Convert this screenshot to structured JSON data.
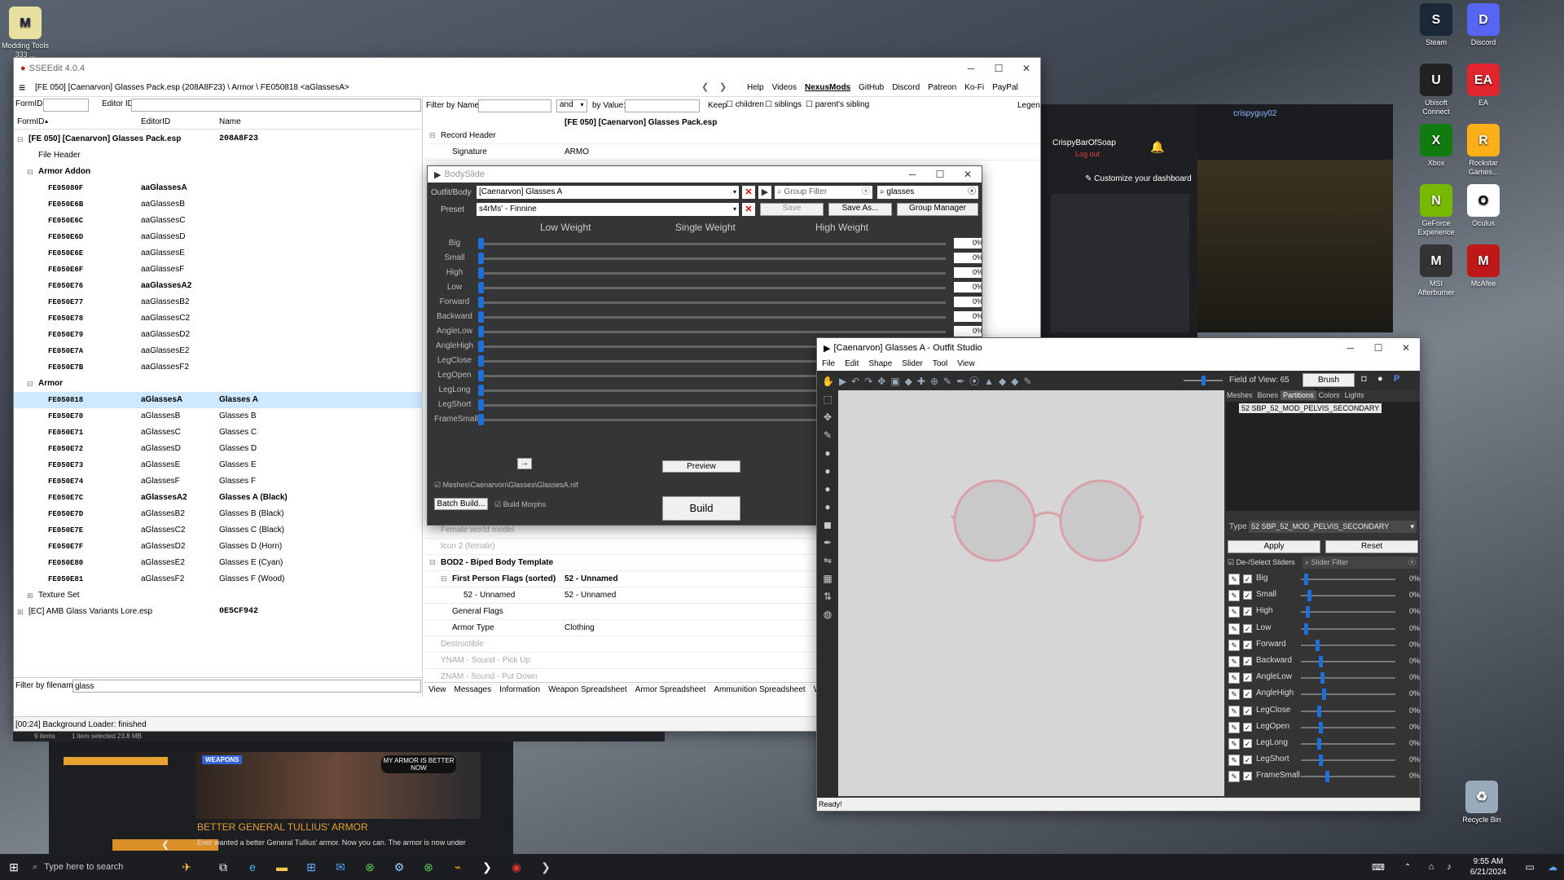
{
  "desktop": {
    "left_icons": [
      {
        "label": "Modding Tools 333 ..."
      }
    ],
    "right_icons": [
      {
        "label": "Steam",
        "color": "#1b2838",
        "glyph": "S"
      },
      {
        "label": "Discord",
        "color": "#5865f2",
        "glyph": "D"
      },
      {
        "label": "Ubisoft Connect",
        "color": "#222",
        "glyph": "U"
      },
      {
        "label": "EA",
        "color": "#e0252e",
        "glyph": "EA"
      },
      {
        "label": "Xbox",
        "color": "#107c10",
        "glyph": "X"
      },
      {
        "label": "Rockstar Games...",
        "color": "#fcaf17",
        "glyph": "R"
      },
      {
        "label": "GeForce Experience",
        "color": "#76b900",
        "glyph": "N"
      },
      {
        "label": "Oculus",
        "color": "#fff",
        "glyph": "O"
      },
      {
        "label": "MSI Afterburner",
        "color": "#333",
        "glyph": "M"
      },
      {
        "label": "McAfee",
        "color": "#c01818",
        "glyph": "M"
      },
      {
        "label": "Recycle Bin",
        "color": "#9ab",
        "glyph": "♻"
      }
    ]
  },
  "sseedit": {
    "title": "SSEEdit 4.0.4",
    "path": "[FE 050] [Caenarvon] Glasses Pack.esp (208A8F23) \\ Armor \\ FE050818 <aGlassesA>",
    "menu": [
      "Help",
      "Videos",
      "NexusMods",
      "GitHub",
      "Discord",
      "Patreon",
      "Ko-Fi",
      "PayPal"
    ],
    "formid_label": "FormID",
    "editorid_label": "Editor ID",
    "columns": [
      "FormID",
      "EditorID",
      "Name"
    ],
    "rows": [
      {
        "c1": "[FE 050] [Caenarvon] Glasses Pack.esp",
        "c3": "208A8F23",
        "indent": 0,
        "bold": true,
        "toggle": "−"
      },
      {
        "c1": "File Header",
        "indent": 1
      },
      {
        "c1": "Armor Addon",
        "indent": 1,
        "bold": true,
        "toggle": "−"
      },
      {
        "c1": "FE05080F",
        "c2": "aaGlassesA",
        "indent": 2,
        "bold": true
      },
      {
        "c1": "FE050E6B",
        "c2": "aaGlassesB",
        "indent": 2
      },
      {
        "c1": "FE050E6C",
        "c2": "aaGlassesC",
        "indent": 2
      },
      {
        "c1": "FE050E6D",
        "c2": "aaGlassesD",
        "indent": 2
      },
      {
        "c1": "FE050E6E",
        "c2": "aaGlassesE",
        "indent": 2
      },
      {
        "c1": "FE050E6F",
        "c2": "aaGlassesF",
        "indent": 2
      },
      {
        "c1": "FE050E76",
        "c2": "aaGlassesA2",
        "indent": 2,
        "bold": true
      },
      {
        "c1": "FE050E77",
        "c2": "aaGlassesB2",
        "indent": 2
      },
      {
        "c1": "FE050E78",
        "c2": "aaGlassesC2",
        "indent": 2
      },
      {
        "c1": "FE050E79",
        "c2": "aaGlassesD2",
        "indent": 2
      },
      {
        "c1": "FE050E7A",
        "c2": "aaGlassesE2",
        "indent": 2
      },
      {
        "c1": "FE050E7B",
        "c2": "aaGlassesF2",
        "indent": 2
      },
      {
        "c1": "Armor",
        "indent": 1,
        "bold": true,
        "toggle": "−"
      },
      {
        "c1": "FE050818",
        "c2": "aGlassesA",
        "c3": "Glasses A",
        "indent": 2,
        "bold": true,
        "selected": true
      },
      {
        "c1": "FE050E70",
        "c2": "aGlassesB",
        "c3": "Glasses B",
        "indent": 2
      },
      {
        "c1": "FE050E71",
        "c2": "aGlassesC",
        "c3": "Glasses C",
        "indent": 2
      },
      {
        "c1": "FE050E72",
        "c2": "aGlassesD",
        "c3": "Glasses D",
        "indent": 2
      },
      {
        "c1": "FE050E73",
        "c2": "aGlassesE",
        "c3": "Glasses E",
        "indent": 2
      },
      {
        "c1": "FE050E74",
        "c2": "aGlassesF",
        "c3": "Glasses F",
        "indent": 2
      },
      {
        "c1": "FE050E7C",
        "c2": "aGlassesA2",
        "c3": "Glasses A (Black)",
        "indent": 2,
        "bold": true
      },
      {
        "c1": "FE050E7D",
        "c2": "aGlassesB2",
        "c3": "Glasses B (Black)",
        "indent": 2
      },
      {
        "c1": "FE050E7E",
        "c2": "aGlassesC2",
        "c3": "Glasses C (Black)",
        "indent": 2
      },
      {
        "c1": "FE050E7F",
        "c2": "aGlassesD2",
        "c3": "Glasses D (Horn)",
        "indent": 2
      },
      {
        "c1": "FE050E80",
        "c2": "aGlassesE2",
        "c3": "Glasses E (Cyan)",
        "indent": 2
      },
      {
        "c1": "FE050E81",
        "c2": "aGlassesF2",
        "c3": "Glasses F (Wood)",
        "indent": 2
      },
      {
        "c1": "Texture Set",
        "indent": 1,
        "toggle": "+"
      },
      {
        "c1": "[EC] AMB Glass Variants Lore.esp",
        "c3": "0E5CF942",
        "indent": 0,
        "toggle": "+"
      }
    ],
    "filter_label": "Filter by filename:",
    "filter_value": "glass",
    "status": "[00:24] Background Loader: finished",
    "filter_name_label": "Filter by Name:",
    "and_label": "and",
    "by_value_label": "by Value:",
    "keep_label": "Keep",
    "children_label": "children",
    "sibling_label": "siblings",
    "parents_sibling_label": "parent's sibling",
    "legend_label": "Legend",
    "record_file": "[FE 050] [Caenarvon] Glasses Pack.esp",
    "record_rows": [
      {
        "k": "Record Header",
        "v": "",
        "indent": 0,
        "toggle": "−"
      },
      {
        "k": "Signature",
        "v": "ARMO",
        "indent": 1
      }
    ],
    "lower_rows": [
      {
        "k": "Female world model",
        "v": "",
        "indent": 0,
        "dim": true
      },
      {
        "k": "Icon 2 (female)",
        "v": "",
        "indent": 0,
        "dim": true
      },
      {
        "k": "BOD2 - Biped Body Template",
        "v": "",
        "indent": 0,
        "bold": true,
        "toggle": "−"
      },
      {
        "k": "First Person Flags (sorted)",
        "v": "52 - Unnamed",
        "indent": 1,
        "bold": true,
        "toggle": "−"
      },
      {
        "k": "52 - Unnamed",
        "v": "52 - Unnamed",
        "indent": 2
      },
      {
        "k": "General Flags",
        "v": "",
        "indent": 1
      },
      {
        "k": "Armor Type",
        "v": "Clothing",
        "indent": 1
      },
      {
        "k": "Destructible",
        "v": "",
        "indent": 0,
        "dim": true
      },
      {
        "k": "YNAM - Sound - Pick Up",
        "v": "",
        "indent": 0,
        "dim": true
      },
      {
        "k": "ZNAM - Sound - Put Down",
        "v": "",
        "indent": 0,
        "dim": true
      }
    ],
    "tabs": [
      "View",
      "Messages",
      "Information",
      "Weapon Spreadsheet",
      "Armor Spreadsheet",
      "Ammunition Spreadsheet",
      "What's New"
    ],
    "items_info": "9 items",
    "selected_info": "1 item selected 23.8 MB"
  },
  "bodyslide": {
    "title": "BodySlide",
    "outfit_label": "Outfit/Body",
    "outfit_value": "[Caenarvon] Glasses A",
    "preset_label": "Preset",
    "preset_value": "s4rMs' - Finnine",
    "group_filter_placeholder": "Group Filter",
    "outfit_filter_value": "glasses",
    "save_label": "Save",
    "save_as_label": "Save As...",
    "group_manager_label": "Group Manager",
    "weights": [
      "Low Weight",
      "Single Weight",
      "High Weight"
    ],
    "sliders": [
      {
        "name": "Big",
        "value": "0%"
      },
      {
        "name": "Small",
        "value": "0%"
      },
      {
        "name": "High",
        "value": "0%"
      },
      {
        "name": "Low",
        "value": "0%"
      },
      {
        "name": "Forward",
        "value": "0%"
      },
      {
        "name": "Backward",
        "value": "0%"
      },
      {
        "name": "AngleLow",
        "value": "0%"
      },
      {
        "name": "AngleHigh",
        "value": ""
      },
      {
        "name": "LegClose",
        "value": ""
      },
      {
        "name": "LegOpen",
        "value": ""
      },
      {
        "name": "LegLong",
        "value": ""
      },
      {
        "name": "LegShort",
        "value": ""
      },
      {
        "name": "FrameSmall",
        "value": ""
      }
    ],
    "arrow_label": "→",
    "preview_label": "Preview",
    "mesh_path": "Meshes\\Caenarvon\\Glasses\\GlassesA.nif",
    "batch_build_label": "Batch Build...",
    "build_morphs_label": "Build Morphs",
    "build_label": "Build"
  },
  "outfitstudio": {
    "title": "[Caenarvon] Glasses A - Outfit Studio",
    "menu": [
      "File",
      "Edit",
      "Shape",
      "Slider",
      "Tool",
      "View"
    ],
    "fov_label": "Field of View: 65",
    "brush_settings_label": "Brush Settings",
    "side_tabs": [
      "Meshes",
      "Bones",
      "Partitions",
      "Colors",
      "Lights"
    ],
    "partition_item": "52 SBP_52_MOD_PELVIS_SECONDARY",
    "type_label": "Type",
    "type_value": "52 SBP_52_MOD_PELVIS_SECONDARY",
    "apply_label": "Apply",
    "reset_label": "Reset",
    "deselect_label": "De-/Select Sliders",
    "slider_filter_placeholder": "Slider Filter",
    "sliders": [
      {
        "name": "Big",
        "value": "0%"
      },
      {
        "name": "Small",
        "value": "0%"
      },
      {
        "name": "High",
        "value": "0%"
      },
      {
        "name": "Low",
        "value": "0%"
      },
      {
        "name": "Forward",
        "value": "0%"
      },
      {
        "name": "Backward",
        "value": "0%"
      },
      {
        "name": "AngleLow",
        "value": "0%"
      },
      {
        "name": "AngleHigh",
        "value": "0%"
      },
      {
        "name": "LegClose",
        "value": "0%"
      },
      {
        "name": "LegOpen",
        "value": "0%"
      },
      {
        "name": "LegLong",
        "value": "0%"
      },
      {
        "name": "LegShort",
        "value": "0%"
      },
      {
        "name": "FrameSmall",
        "value": "0%"
      }
    ],
    "status": "Ready!"
  },
  "xbox_overlay": {
    "user": "CrispyBarOfSoap",
    "logout": "Log out",
    "customize": "Customize your dashboard",
    "steam_user": "crispyguy02"
  },
  "nexus_card": {
    "badge": "WEAPONS",
    "meme": "MY ARMOR IS BETTER NOW",
    "title": "BETTER GENERAL TULLIUS' ARMOR",
    "desc": "Ever wanted a better General Tullius' armor. Now you can. The armor is now under"
  },
  "taskbar": {
    "search_placeholder": "Type here to search",
    "time": "9:55 AM",
    "date": "6/21/2024"
  }
}
